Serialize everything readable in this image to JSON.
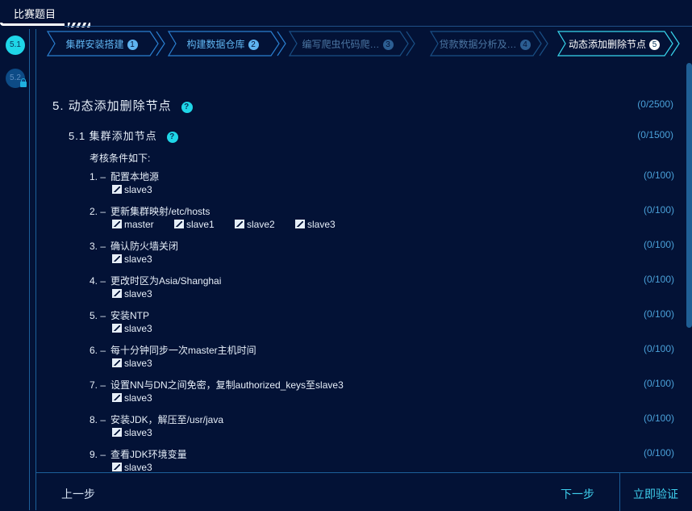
{
  "header": {
    "title": "比赛题目"
  },
  "nav": {
    "active": "5.1",
    "locked": "5.2"
  },
  "steps": [
    {
      "label": "集群安装搭建",
      "num": "1",
      "state": "done"
    },
    {
      "label": "构建数据仓库",
      "num": "2",
      "state": "done"
    },
    {
      "label": "编写爬虫代码爬…",
      "num": "3",
      "state": "disabled"
    },
    {
      "label": "贷款数据分析及…",
      "num": "4",
      "state": "disabled"
    },
    {
      "label": "动态添加删除节点",
      "num": "5",
      "state": "active"
    }
  ],
  "section": {
    "title": "5. 动态添加删除节点",
    "score": "(0/2500)"
  },
  "subsection": {
    "title": "5.1  集群添加节点",
    "score": "(0/1500)"
  },
  "conditions_label": "考核条件如下:",
  "items": [
    {
      "num": "1. –",
      "text": "配置本地源",
      "score": "(0/100)",
      "hosts": [
        "slave3"
      ]
    },
    {
      "num": "2. –",
      "text": "更新集群映射/etc/hosts",
      "score": "(0/100)",
      "hosts": [
        "master",
        "slave1",
        "slave2",
        "slave3"
      ]
    },
    {
      "num": "3. –",
      "text": "确认防火墙关闭",
      "score": "(0/100)",
      "hosts": [
        "slave3"
      ]
    },
    {
      "num": "4. –",
      "text": "更改时区为Asia/Shanghai",
      "score": "(0/100)",
      "hosts": [
        "slave3"
      ]
    },
    {
      "num": "5. –",
      "text": "安装NTP",
      "score": "(0/100)",
      "hosts": [
        "slave3"
      ]
    },
    {
      "num": "6. –",
      "text": "每十分钟同步一次master主机时间",
      "score": "(0/100)",
      "hosts": [
        "slave3"
      ]
    },
    {
      "num": "7. –",
      "text": "设置NN与DN之间免密，复制authorized_keys至slave3",
      "score": "(0/100)",
      "hosts": [
        "slave3"
      ]
    },
    {
      "num": "8. –",
      "text": "安装JDK，解压至/usr/java",
      "score": "(0/100)",
      "hosts": [
        "slave3"
      ]
    },
    {
      "num": "9. –",
      "text": "查看JDK环境变量",
      "score": "(0/100)",
      "hosts": [
        "slave3"
      ]
    }
  ],
  "footer": {
    "prev": "上一步",
    "next": "下一步",
    "verify": "立即验证"
  },
  "colors": {
    "bg": "#031236",
    "accent": "#1fd6e8",
    "border": "#1c5f99",
    "score": "#4aa0d8"
  },
  "icons": {
    "host": "host-image-icon",
    "help": "help-icon",
    "lock": "lock-icon"
  }
}
